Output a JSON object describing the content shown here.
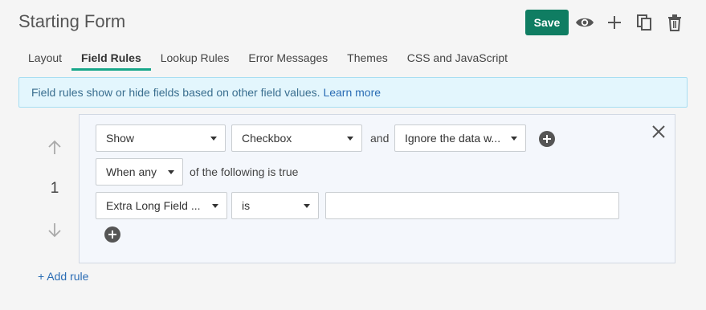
{
  "header": {
    "title": "Starting Form",
    "save_label": "Save",
    "icons": [
      "eye-icon",
      "plus-icon",
      "copy-icon",
      "trash-icon"
    ]
  },
  "tabs": [
    {
      "label": "Layout",
      "active": false
    },
    {
      "label": "Field Rules",
      "active": true
    },
    {
      "label": "Lookup Rules",
      "active": false
    },
    {
      "label": "Error Messages",
      "active": false
    },
    {
      "label": "Themes",
      "active": false
    },
    {
      "label": "CSS and JavaScript",
      "active": false
    }
  ],
  "info": {
    "text": "Field rules show or hide fields based on other field values.",
    "link": "Learn more"
  },
  "rule": {
    "number": "1",
    "action": "Show",
    "field": "Checkbox",
    "and_label": "and",
    "data_option": "Ignore the data w...",
    "condition_mode": "When any",
    "condition_suffix": "of the following is true",
    "condition": {
      "field": "Extra Long Field ...",
      "operator": "is",
      "value": ""
    }
  },
  "add_rule_label": "+ Add rule",
  "colors": {
    "save": "#0f7d62",
    "active_tab": "#17a689",
    "banner_bg": "#e3f6fd",
    "link": "#2a6cb4"
  }
}
